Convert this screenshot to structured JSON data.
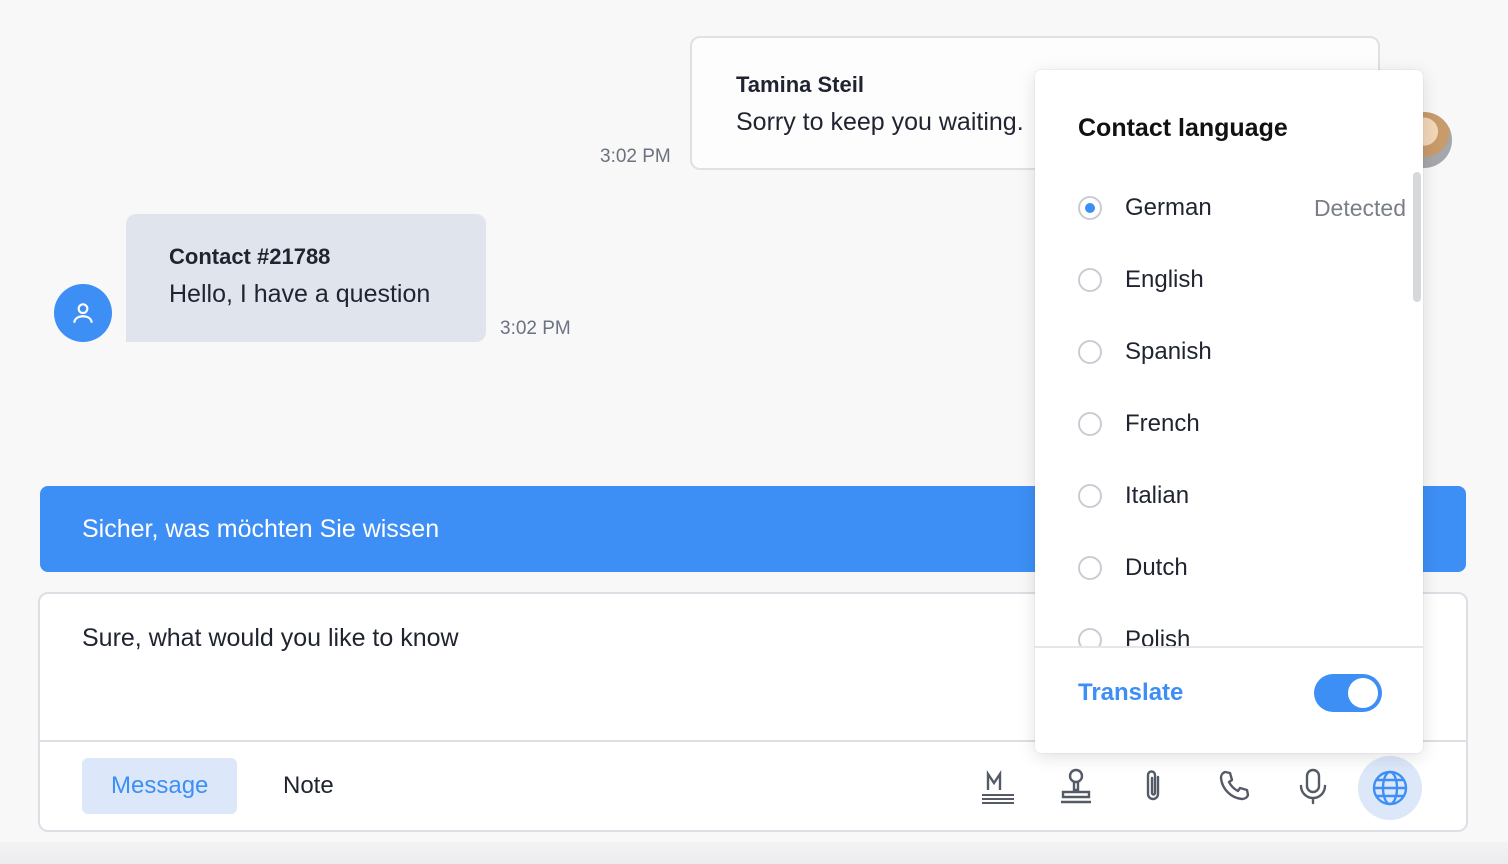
{
  "conversation": {
    "agent_message": {
      "author": "Tamina Steil",
      "text": "Sorry to keep you waiting.",
      "time": "3:02 PM"
    },
    "contact_message": {
      "author": "Contact #21788",
      "text": "Hello, I have a question",
      "time": "3:02 PM"
    }
  },
  "translation_preview": "Sicher, was möchten Sie wissen",
  "composer": {
    "text": "Sure, what would you like to know",
    "tabs": {
      "message": "Message",
      "note": "Note"
    }
  },
  "language_popover": {
    "title": "Contact language",
    "languages": [
      {
        "label": "German",
        "tag": "Detected",
        "selected": true
      },
      {
        "label": "English",
        "selected": false
      },
      {
        "label": "Spanish",
        "selected": false
      },
      {
        "label": "French",
        "selected": false
      },
      {
        "label": "Italian",
        "selected": false
      },
      {
        "label": "Dutch",
        "selected": false
      },
      {
        "label": "Polish",
        "selected": false
      }
    ],
    "translate_label": "Translate",
    "translate_enabled": true
  },
  "colors": {
    "accent": "#3d8ff5",
    "contact_bubble": "#e0e4ed",
    "active_tab_bg": "#dce8fa"
  },
  "toolbar_icons": [
    "markdown-icon",
    "stamp-icon",
    "paperclip-icon",
    "phone-icon",
    "microphone-icon",
    "globe-icon"
  ]
}
